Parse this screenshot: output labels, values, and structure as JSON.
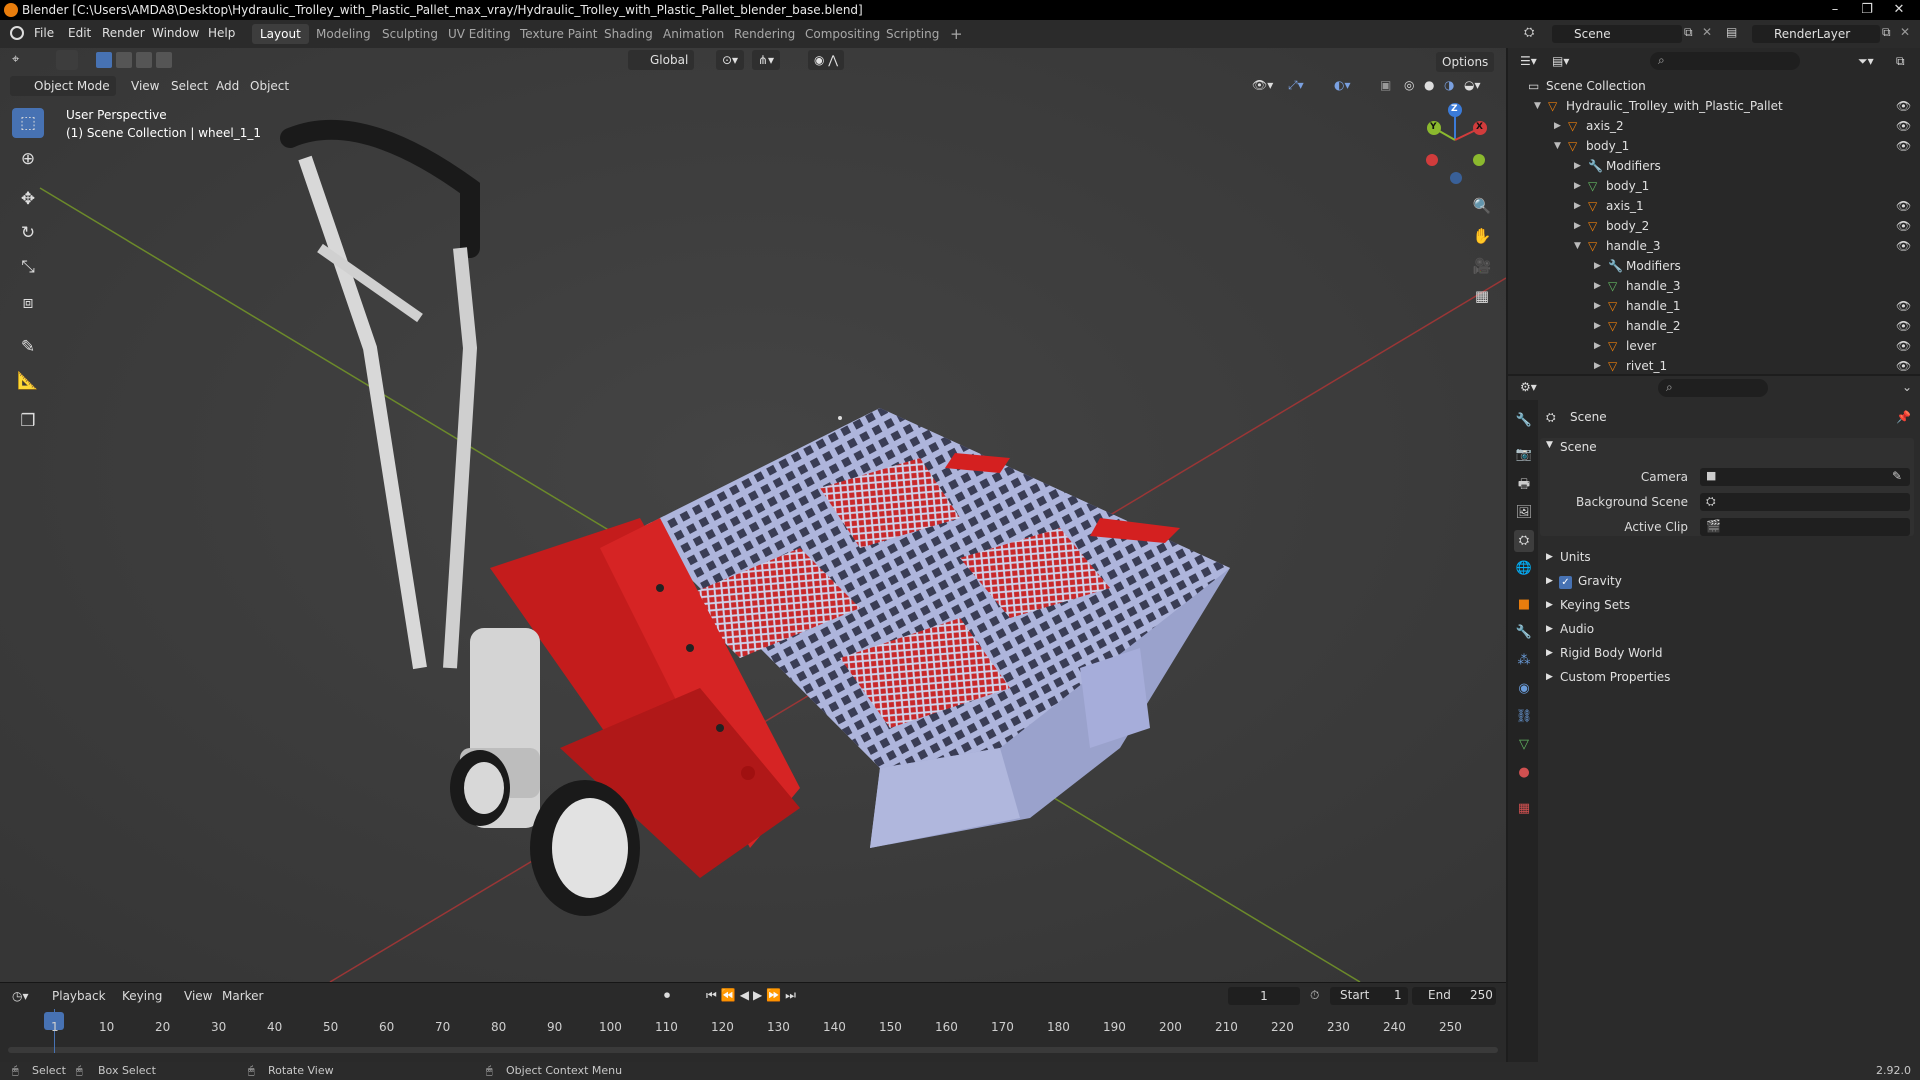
{
  "title_bar": {
    "text": "Blender [C:\\Users\\AMDA8\\Desktop\\Hydraulic_Trolley_with_Plastic_Pallet_max_vray/Hydraulic_Trolley_with_Plastic_Pallet_blender_base.blend]"
  },
  "menu": [
    "File",
    "Edit",
    "Render",
    "Window",
    "Help"
  ],
  "workspaces": [
    "Layout",
    "Modeling",
    "Sculpting",
    "UV Editing",
    "Texture Paint",
    "Shading",
    "Animation",
    "Rendering",
    "Compositing",
    "Scripting"
  ],
  "scene_field": "Scene",
  "render_layer_field": "RenderLayer",
  "viewport": {
    "mode": "Object Mode",
    "menus": [
      "View",
      "Select",
      "Add",
      "Object"
    ],
    "transform_orientation": "Global",
    "options_label": "Options",
    "overlay_line1": "User Perspective",
    "overlay_line2": "(1) Scene Collection | wheel_1_1"
  },
  "gizmo": {
    "z": "Z",
    "y": "Y",
    "x": "X"
  },
  "outliner": {
    "rows": [
      {
        "label": "Scene Collection",
        "depth": 0,
        "icon": "collection",
        "tri": "",
        "eye": false
      },
      {
        "label": "Hydraulic_Trolley_with_Plastic_Pallet",
        "depth": 1,
        "icon": "object",
        "tri": "▼",
        "eye": true
      },
      {
        "label": "axis_2",
        "depth": 2,
        "icon": "object",
        "tri": "▶",
        "eye": true
      },
      {
        "label": "body_1",
        "depth": 2,
        "icon": "object",
        "tri": "▼",
        "eye": true
      },
      {
        "label": "Modifiers",
        "depth": 3,
        "icon": "wrench",
        "tri": "▶",
        "eye": false
      },
      {
        "label": "body_1",
        "depth": 3,
        "icon": "mesh",
        "tri": "▶",
        "eye": false
      },
      {
        "label": "axis_1",
        "depth": 3,
        "icon": "object",
        "tri": "▶",
        "eye": true
      },
      {
        "label": "body_2",
        "depth": 3,
        "icon": "object",
        "tri": "▶",
        "eye": true
      },
      {
        "label": "handle_3",
        "depth": 3,
        "icon": "object",
        "tri": "▼",
        "eye": true
      },
      {
        "label": "Modifiers",
        "depth": 4,
        "icon": "wrench",
        "tri": "▶",
        "eye": false
      },
      {
        "label": "handle_3",
        "depth": 4,
        "icon": "mesh",
        "tri": "▶",
        "eye": false
      },
      {
        "label": "handle_1",
        "depth": 4,
        "icon": "object",
        "tri": "▶",
        "eye": true
      },
      {
        "label": "handle_2",
        "depth": 4,
        "icon": "object",
        "tri": "▶",
        "eye": true
      },
      {
        "label": "lever",
        "depth": 4,
        "icon": "object",
        "tri": "▶",
        "eye": true
      },
      {
        "label": "rivet_1",
        "depth": 4,
        "icon": "object",
        "tri": "▶",
        "eye": true
      }
    ]
  },
  "properties": {
    "header": "Scene",
    "panel_title": "Scene",
    "fields": [
      {
        "label": "Camera",
        "value": ""
      },
      {
        "label": "Background Scene",
        "value": ""
      },
      {
        "label": "Active Clip",
        "value": ""
      }
    ],
    "sections": [
      "Units",
      "Gravity",
      "Keying Sets",
      "Audio",
      "Rigid Body World",
      "Custom Properties"
    ]
  },
  "timeline": {
    "menus": [
      "Playback",
      "Keying",
      "View",
      "Marker"
    ],
    "current_frame": "1",
    "start_label": "Start",
    "start_value": "1",
    "end_label": "End",
    "end_value": "250",
    "ticks": [
      "1",
      "10",
      "20",
      "30",
      "40",
      "50",
      "60",
      "70",
      "80",
      "90",
      "100",
      "110",
      "120",
      "130",
      "140",
      "150",
      "160",
      "170",
      "180",
      "190",
      "200",
      "210",
      "220",
      "230",
      "240",
      "250"
    ]
  },
  "status_bar": {
    "select": "Select",
    "box_select": "Box Select",
    "rotate_view": "Rotate View",
    "context_menu": "Object Context Menu",
    "version": "2.92.0"
  },
  "colors": {
    "accent": "#4772b3",
    "orange": "#e87d0d",
    "pallet": "#b4bbe0",
    "trolley_red": "#d42020"
  }
}
